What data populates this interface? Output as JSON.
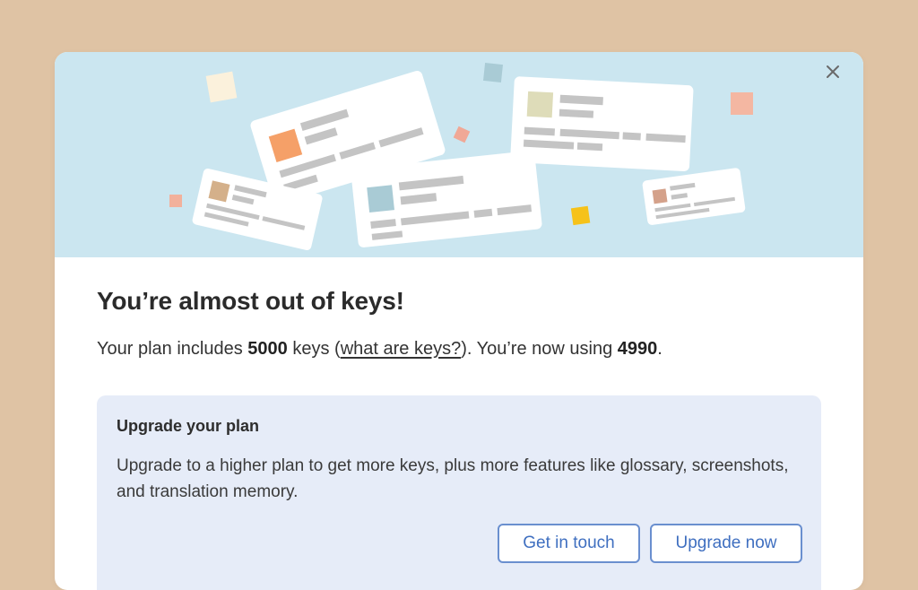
{
  "dialog": {
    "close_icon": "close-icon",
    "title": "You’re almost out of keys!",
    "plan": {
      "prefix": "Your plan includes ",
      "limit": "5000",
      "middle": " keys (",
      "link": "what are keys?",
      "suffix": "). You’re now using ",
      "used": "4990",
      "end": "."
    },
    "upgrade": {
      "title": "Upgrade your plan",
      "description": "Upgrade to a higher plan to get more keys, plus more features like glossary, screenshots, and translation memory.",
      "contact_label": "Get in touch",
      "upgrade_label": "Upgrade now"
    }
  },
  "colors": {
    "page_background": "#dfc3a4",
    "hero_background": "#cbe6f0",
    "box_background": "#e6ecf8",
    "button_accent": "#3f6fc0"
  }
}
